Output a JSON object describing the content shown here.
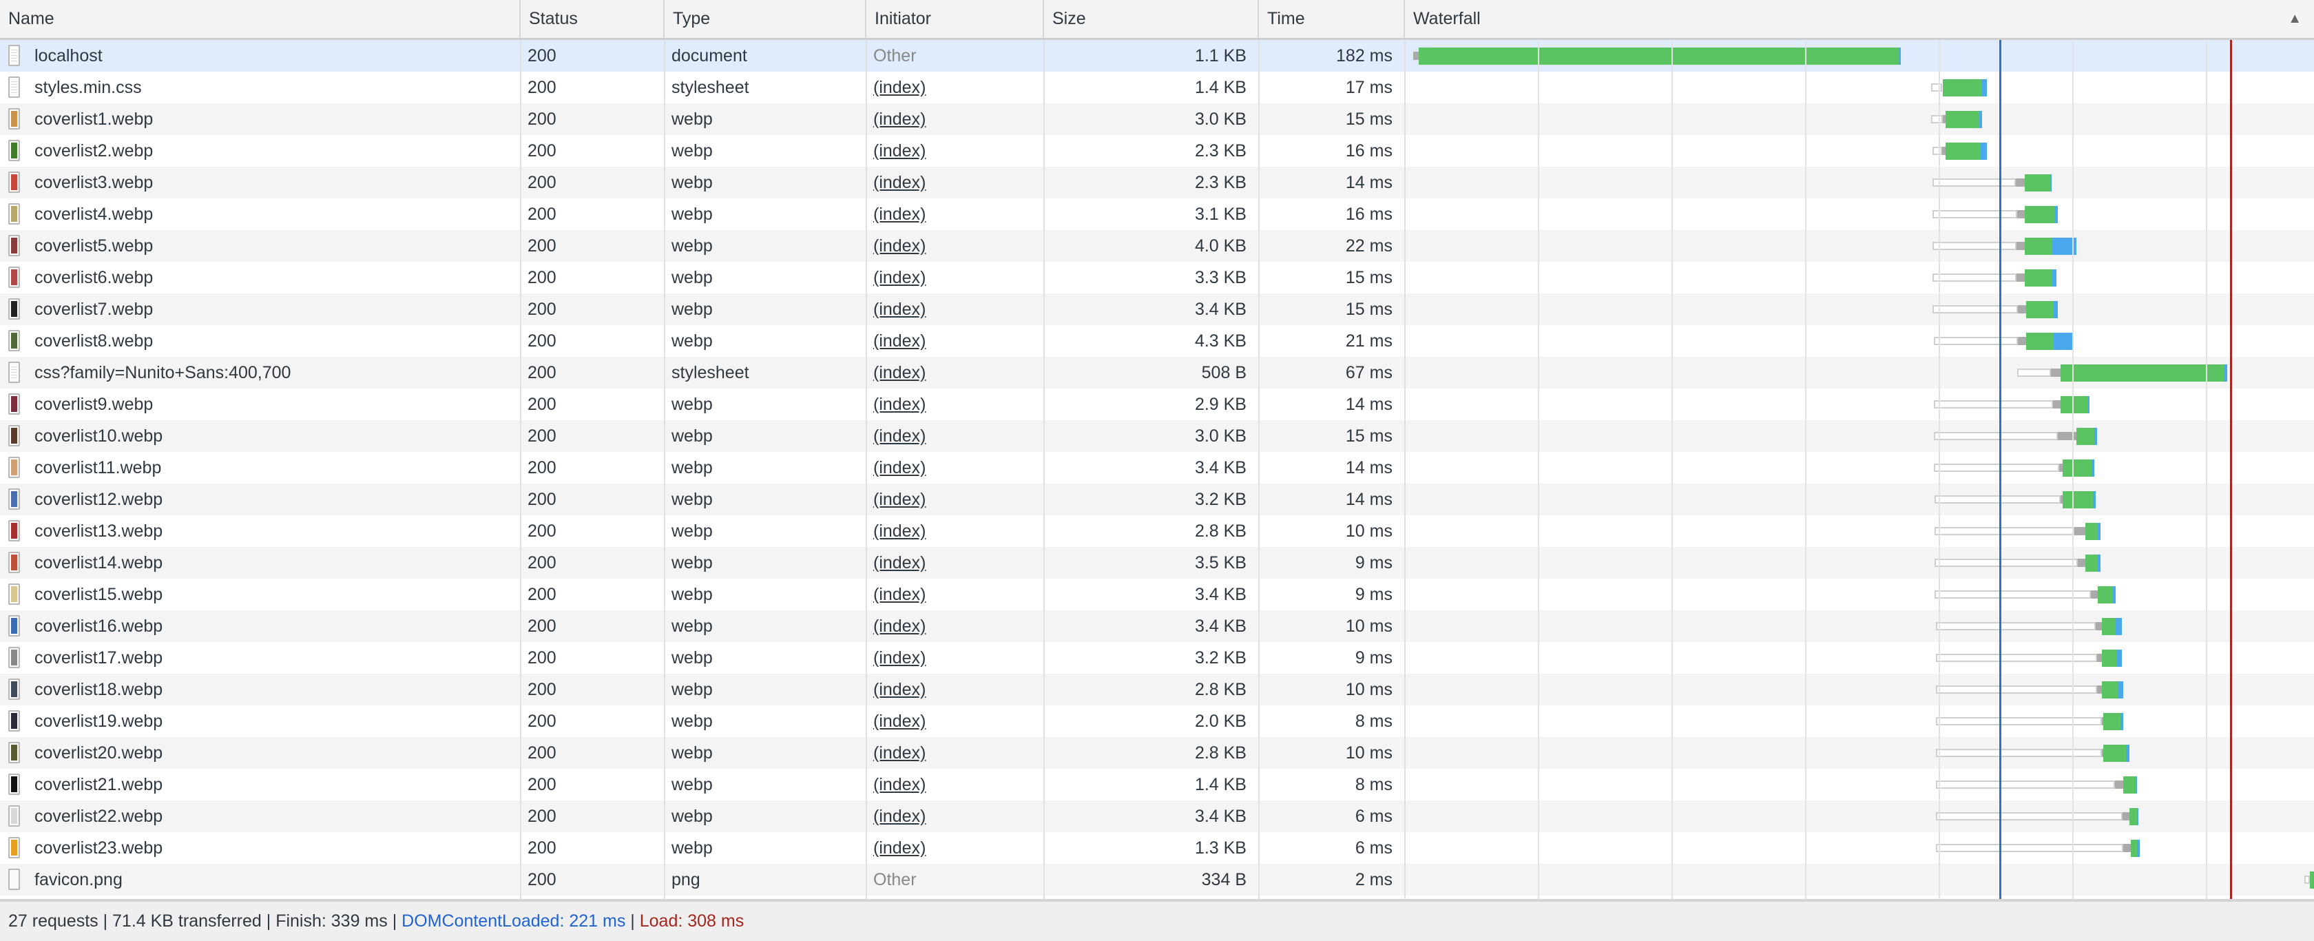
{
  "columns": {
    "name": "Name",
    "status": "Status",
    "type": "Type",
    "initiator": "Initiator",
    "size": "Size",
    "time": "Time",
    "waterfall": "Waterfall",
    "sort_icon": "▲"
  },
  "colors": {
    "selected_row": "#e0ecfb",
    "stripe": "#f4f4f4",
    "queue": "#ffffff",
    "stalled": "#aaaaaa",
    "waiting": "#5ac463",
    "download": "#4aa8ec",
    "dcl": "#2f6fd0",
    "load": "#a6261f"
  },
  "timeline": {
    "dom_content_loaded_ms": 221,
    "load_ms": 308
  },
  "requests": [
    {
      "name": "localhost",
      "status": "200",
      "type": "document",
      "initiator": "Other",
      "size": "1.1 KB",
      "time": "182 ms",
      "thumb": "doc",
      "selected": true,
      "timing_ms": [
        0,
        0,
        2,
        183,
        184
      ]
    },
    {
      "name": "styles.min.css",
      "status": "200",
      "type": "stylesheet",
      "initiator": "(index)",
      "size": "1.4 KB",
      "time": "17 ms",
      "thumb": "doc",
      "timing_ms": [
        195.3,
        199.5,
        199.7,
        214.5,
        216.4
      ]
    },
    {
      "name": "coverlist1.webp",
      "status": "200",
      "type": "webp",
      "initiator": "(index)",
      "size": "3.0 KB",
      "time": "15 ms",
      "thumb": "#c9914a",
      "timing_ms": [
        195.3,
        199.7,
        200.8,
        213.5,
        214.5
      ]
    },
    {
      "name": "coverlist2.webp",
      "status": "200",
      "type": "webp",
      "initiator": "(index)",
      "size": "2.3 KB",
      "time": "16 ms",
      "thumb": "#3f7d2a",
      "timing_ms": [
        195.8,
        199.5,
        200.8,
        214.0,
        216.4
      ]
    },
    {
      "name": "coverlist3.webp",
      "status": "200",
      "type": "webp",
      "initiator": "(index)",
      "size": "2.3 KB",
      "time": "14 ms",
      "thumb": "#c8453a",
      "timing_ms": [
        195.8,
        227.3,
        230.6,
        240.3,
        240.8
      ]
    },
    {
      "name": "coverlist4.webp",
      "status": "200",
      "type": "webp",
      "initiator": "(index)",
      "size": "3.1 KB",
      "time": "16 ms",
      "thumb": "#b8a86a",
      "timing_ms": [
        195.8,
        227.8,
        230.6,
        242.1,
        243.1
      ]
    },
    {
      "name": "coverlist5.webp",
      "status": "200",
      "type": "webp",
      "initiator": "(index)",
      "size": "4.0 KB",
      "time": "22 ms",
      "thumb": "#8a3b3b",
      "timing_ms": [
        195.8,
        227.5,
        230.6,
        241.0,
        250.1
      ]
    },
    {
      "name": "coverlist6.webp",
      "status": "200",
      "type": "webp",
      "initiator": "(index)",
      "size": "3.3 KB",
      "time": "15 ms",
      "thumb": "#b04848",
      "timing_ms": [
        195.8,
        227.5,
        230.6,
        240.8,
        242.6
      ]
    },
    {
      "name": "coverlist7.webp",
      "status": "200",
      "type": "webp",
      "initiator": "(index)",
      "size": "3.4 KB",
      "time": "15 ms",
      "thumb": "#222222",
      "timing_ms": [
        195.8,
        228.1,
        231.2,
        241.6,
        243.1
      ]
    },
    {
      "name": "coverlist8.webp",
      "status": "200",
      "type": "webp",
      "initiator": "(index)",
      "size": "4.3 KB",
      "time": "21 ms",
      "thumb": "#4f6b3a",
      "timing_ms": [
        196.4,
        228.1,
        231.2,
        241.6,
        248.8
      ]
    },
    {
      "name": "css?family=Nunito+Sans:400,700",
      "status": "200",
      "type": "stylesheet",
      "initiator": "(index)",
      "size": "508 B",
      "time": "67 ms",
      "thumb": "doc",
      "timing_ms": [
        227.8,
        240.5,
        244.2,
        306.0,
        307.0
      ]
    },
    {
      "name": "coverlist9.webp",
      "status": "200",
      "type": "webp",
      "initiator": "(index)",
      "size": "2.9 KB",
      "time": "14 ms",
      "thumb": "#7a2f3a",
      "timing_ms": [
        196.4,
        241.3,
        244.2,
        254.5,
        255.1
      ]
    },
    {
      "name": "coverlist10.webp",
      "status": "200",
      "type": "webp",
      "initiator": "(index)",
      "size": "3.0 KB",
      "time": "15 ms",
      "thumb": "#5a3a2a",
      "timing_ms": [
        196.4,
        243.1,
        250.1,
        256.9,
        257.9
      ]
    },
    {
      "name": "coverlist11.webp",
      "status": "200",
      "type": "webp",
      "initiator": "(index)",
      "size": "3.4 KB",
      "time": "14 ms",
      "thumb": "#d0a070",
      "timing_ms": [
        196.4,
        243.6,
        244.9,
        255.8,
        256.9
      ]
    },
    {
      "name": "coverlist12.webp",
      "status": "200",
      "type": "webp",
      "initiator": "(index)",
      "size": "3.2 KB",
      "time": "14 ms",
      "thumb": "#4a6fb0",
      "timing_ms": [
        196.6,
        244.2,
        244.9,
        256.4,
        257.4
      ]
    },
    {
      "name": "coverlist13.webp",
      "status": "200",
      "type": "webp",
      "initiator": "(index)",
      "size": "2.8 KB",
      "time": "10 ms",
      "thumb": "#a83030",
      "timing_ms": [
        196.6,
        249.4,
        253.5,
        258.2,
        259.2
      ]
    },
    {
      "name": "coverlist14.webp",
      "status": "200",
      "type": "webp",
      "initiator": "(index)",
      "size": "3.5 KB",
      "time": "9 ms",
      "thumb": "#c0503a",
      "timing_ms": [
        196.6,
        250.6,
        253.5,
        258.2,
        259.2
      ]
    },
    {
      "name": "coverlist15.webp",
      "status": "200",
      "type": "webp",
      "initiator": "(index)",
      "size": "3.4 KB",
      "time": "9 ms",
      "thumb": "#d8c890",
      "timing_ms": [
        196.6,
        255.6,
        258.2,
        263.9,
        264.9
      ]
    },
    {
      "name": "coverlist16.webp",
      "status": "200",
      "type": "webp",
      "initiator": "(index)",
      "size": "3.4 KB",
      "time": "10 ms",
      "thumb": "#3a6ab0",
      "timing_ms": [
        197.1,
        257.4,
        259.7,
        264.9,
        267.3
      ]
    },
    {
      "name": "coverlist17.webp",
      "status": "200",
      "type": "webp",
      "initiator": "(index)",
      "size": "3.2 KB",
      "time": "9 ms",
      "thumb": "#888888",
      "timing_ms": [
        197.1,
        257.9,
        259.7,
        265.5,
        267.3
      ]
    },
    {
      "name": "coverlist18.webp",
      "status": "200",
      "type": "webp",
      "initiator": "(index)",
      "size": "2.8 KB",
      "time": "10 ms",
      "thumb": "#404a5a",
      "timing_ms": [
        197.1,
        257.9,
        259.7,
        266.0,
        267.8
      ]
    },
    {
      "name": "coverlist19.webp",
      "status": "200",
      "type": "webp",
      "initiator": "(index)",
      "size": "2.0 KB",
      "time": "8 ms",
      "thumb": "#2a2a3a",
      "timing_ms": [
        197.1,
        259.7,
        260.3,
        266.7,
        267.8
      ]
    },
    {
      "name": "coverlist20.webp",
      "status": "200",
      "type": "webp",
      "initiator": "(index)",
      "size": "2.8 KB",
      "time": "10 ms",
      "thumb": "#5a5a30",
      "timing_ms": [
        197.1,
        259.7,
        260.3,
        268.8,
        270.1
      ]
    },
    {
      "name": "coverlist21.webp",
      "status": "200",
      "type": "webp",
      "initiator": "(index)",
      "size": "1.4 KB",
      "time": "8 ms",
      "thumb": "#111111",
      "timing_ms": [
        197.1,
        264.7,
        267.8,
        272.5,
        273.0
      ]
    },
    {
      "name": "coverlist22.webp",
      "status": "200",
      "type": "webp",
      "initiator": "(index)",
      "size": "3.4 KB",
      "time": "6 ms",
      "thumb": "#d8d8d8",
      "timing_ms": [
        197.1,
        267.5,
        270.1,
        273.0,
        273.5
      ]
    },
    {
      "name": "coverlist23.webp",
      "status": "200",
      "type": "webp",
      "initiator": "(index)",
      "size": "1.3 KB",
      "time": "6 ms",
      "thumb": "#e8a020",
      "timing_ms": [
        197.1,
        267.8,
        270.6,
        273.0,
        274.0
      ]
    },
    {
      "name": "favicon.png",
      "status": "200",
      "type": "png",
      "initiator": "Other",
      "size": "334 B",
      "time": "2 ms",
      "thumb": "blank",
      "timing_ms": [
        336.1,
        338.2,
        338.2,
        339.5,
        339.8
      ]
    }
  ],
  "footer": {
    "summary": "27 requests | 71.4 KB transferred | Finish: 339 ms | ",
    "dcl": "DOMContentLoaded: 221 ms",
    "sep": " | ",
    "load": "Load: 308 ms"
  }
}
